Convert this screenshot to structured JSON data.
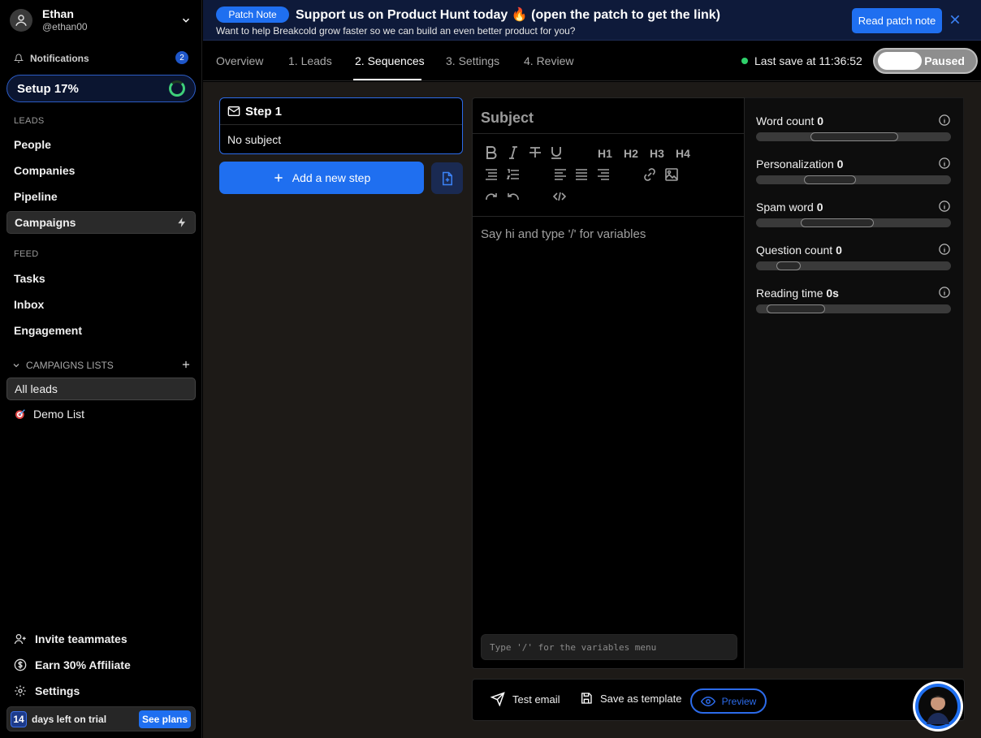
{
  "user": {
    "name": "Ethan",
    "handle": "@ethan00"
  },
  "sidebar": {
    "notifications_label": "Notifications",
    "notifications_count": "2",
    "setup_label": "Setup 17%",
    "setup_progress": 0.17,
    "leads_section": "LEADS",
    "leads_items": [
      "People",
      "Companies",
      "Pipeline",
      "Campaigns"
    ],
    "feed_section": "FEED",
    "feed_items": [
      "Tasks",
      "Inbox",
      "Engagement"
    ],
    "campaign_lists_label": "CAMPAIGNS LISTS",
    "all_leads": "All leads",
    "demo_list": "Demo List",
    "invite": "Invite teammates",
    "affiliate": "Earn 30% Affiliate",
    "settings": "Settings",
    "trial_days": "14",
    "trial_text": "days left on trial",
    "see_plans": "See plans"
  },
  "banner": {
    "pill": "Patch Note",
    "title": "Support us on Product Hunt today 🔥 (open the patch to get the link)",
    "subtitle": "Want to help Breakcold grow faster so we can build an even better product for you?",
    "button": "Read patch note"
  },
  "tabs": [
    "Overview",
    "1. Leads",
    "2. Sequences",
    "3. Settings",
    "4. Review"
  ],
  "active_tab": "2. Sequences",
  "save_status": "Last save at 11:36:52",
  "toggle_label": "Paused",
  "step": {
    "title": "Step 1",
    "subject": "No subject"
  },
  "add_step_label": "Add a new step",
  "editor": {
    "subject_placeholder": "Subject",
    "headings": [
      "H1",
      "H2",
      "H3",
      "H4"
    ],
    "body_placeholder": "Say hi and type '/' for variables",
    "variables_placeholder": "Type '/' for the variables menu"
  },
  "stats": [
    {
      "label": "Word count",
      "value": "0"
    },
    {
      "label": "Personalization",
      "value": "0"
    },
    {
      "label": "Spam word",
      "value": "0"
    },
    {
      "label": "Question count",
      "value": "0"
    },
    {
      "label": "Reading time",
      "value": "0s"
    }
  ],
  "actions": {
    "test_email": "Test email",
    "save_template": "Save as template",
    "preview": "Preview"
  },
  "colors": {
    "accent": "#1f6ff0",
    "banner_bg": "#0e1a3a",
    "main_bg": "#1d1a17",
    "save_dot": "#2fd16b"
  }
}
